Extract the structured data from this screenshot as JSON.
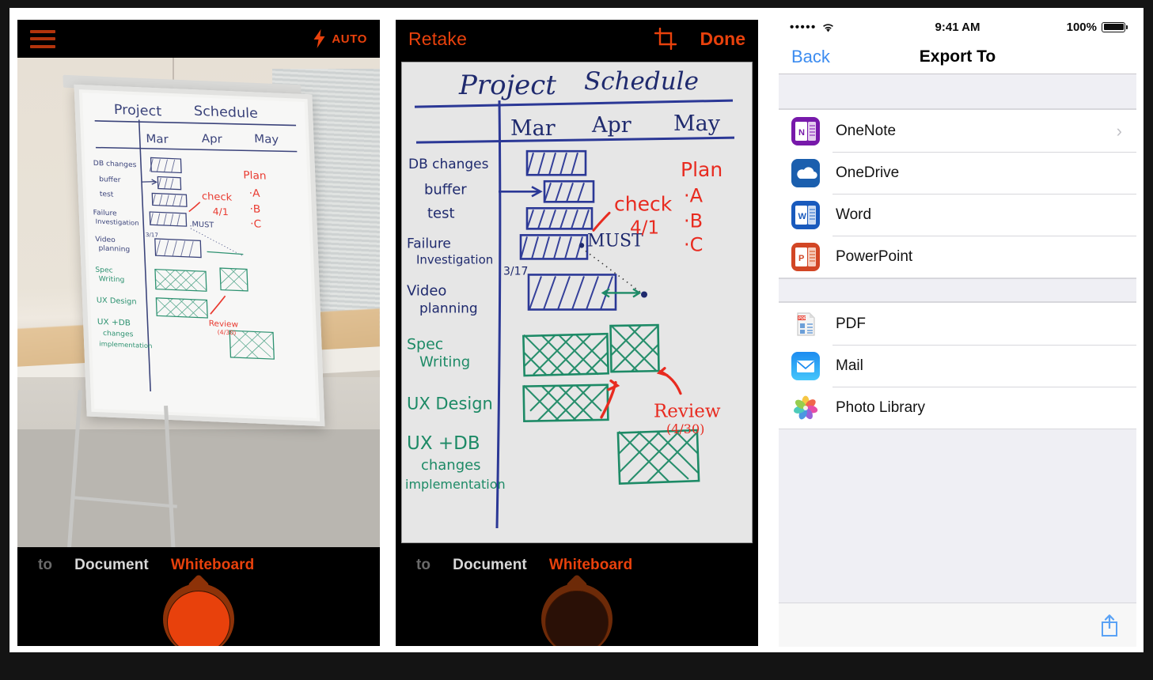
{
  "panels": {
    "camera_live": {
      "name": "Office Lens camera live view",
      "topbar": {
        "menu_icon": "hamburger-menu-icon",
        "flash_icon": "flash-bolt-icon",
        "flash_label": "AUTO"
      },
      "modes": [
        {
          "label": "to",
          "state": "cut-off"
        },
        {
          "label": "Document",
          "state": "inactive"
        },
        {
          "label": "Whiteboard",
          "state": "active"
        }
      ],
      "shutter": {
        "icon": "camera-shutter-button",
        "enabled": true
      }
    },
    "camera_review": {
      "name": "Captured whiteboard review",
      "topbar": {
        "retake_label": "Retake",
        "crop_icon": "crop-icon",
        "done_label": "Done"
      },
      "modes": [
        {
          "label": "to",
          "state": "cut-off"
        },
        {
          "label": "Document",
          "state": "inactive"
        },
        {
          "label": "Whiteboard",
          "state": "active"
        }
      ],
      "shutter": {
        "icon": "camera-shutter-button",
        "enabled": false
      }
    },
    "export": {
      "statusbar": {
        "signal": "•••••",
        "wifi_icon": "wifi-icon",
        "time": "9:41 AM",
        "battery_pct": "100%",
        "battery_icon": "battery-full-icon"
      },
      "navbar": {
        "back_label": "Back",
        "title": "Export To"
      },
      "groups": [
        {
          "items": [
            {
              "label": "OneNote",
              "icon": "onenote-icon",
              "color": "#7719aa",
              "accessory": "chevron-right-icon"
            },
            {
              "label": "OneDrive",
              "icon": "onedrive-icon",
              "color": "#1b5fae",
              "accessory": ""
            },
            {
              "label": "Word",
              "icon": "word-icon",
              "color": "#195abd",
              "accessory": ""
            },
            {
              "label": "PowerPoint",
              "icon": "powerpoint-icon",
              "color": "#d24625",
              "accessory": ""
            }
          ]
        },
        {
          "items": [
            {
              "label": "PDF",
              "icon": "pdf-document-icon",
              "color": "#ffffff",
              "accessory": ""
            },
            {
              "label": "Mail",
              "icon": "mail-icon",
              "color": "#2aa6f5",
              "accessory": ""
            },
            {
              "label": "Photo Library",
              "icon": "photos-icon",
              "color": "#ffffff",
              "accessory": ""
            }
          ]
        }
      ],
      "toolbar": {
        "share_icon": "share-export-icon"
      }
    }
  },
  "whiteboard": {
    "title_left": "Project",
    "title_right": "Schedule",
    "months": [
      "Mar",
      "Apr",
      "May"
    ],
    "rows": [
      {
        "label": "DB changes",
        "label2": "",
        "color": "navy"
      },
      {
        "label": "buffer",
        "label2": "",
        "color": "navy"
      },
      {
        "label": "test",
        "label2": "",
        "color": "navy"
      },
      {
        "label": "Failure",
        "label2": "Investigation",
        "color": "navy"
      },
      {
        "label": "Video",
        "label2": "planning",
        "color": "navy"
      },
      {
        "label": "Spec",
        "label2": "Writing",
        "color": "green"
      },
      {
        "label": "UX Design",
        "label2": "",
        "color": "green"
      },
      {
        "label": "UX + DB",
        "label2": "changes",
        "label3": "implementation",
        "color": "green"
      }
    ],
    "annotations": [
      {
        "text": "Plan",
        "color": "red"
      },
      {
        "text": "·A",
        "color": "red"
      },
      {
        "text": "·B",
        "color": "red"
      },
      {
        "text": "·C",
        "color": "red"
      },
      {
        "text": "check",
        "color": "red"
      },
      {
        "text": "4/1",
        "color": "red"
      },
      {
        "text": "MUST",
        "color": "navy"
      },
      {
        "text": "3/17",
        "color": "navy"
      },
      {
        "text": "Review",
        "color": "red"
      },
      {
        "text": "(4/30)",
        "color": "red"
      }
    ]
  },
  "colors": {
    "accent_orange": "#e8410c",
    "ios_blue": "#3c8cf0",
    "navy_ink": "#25307a",
    "green_ink": "#1d8a66",
    "red_ink": "#e82b20"
  }
}
